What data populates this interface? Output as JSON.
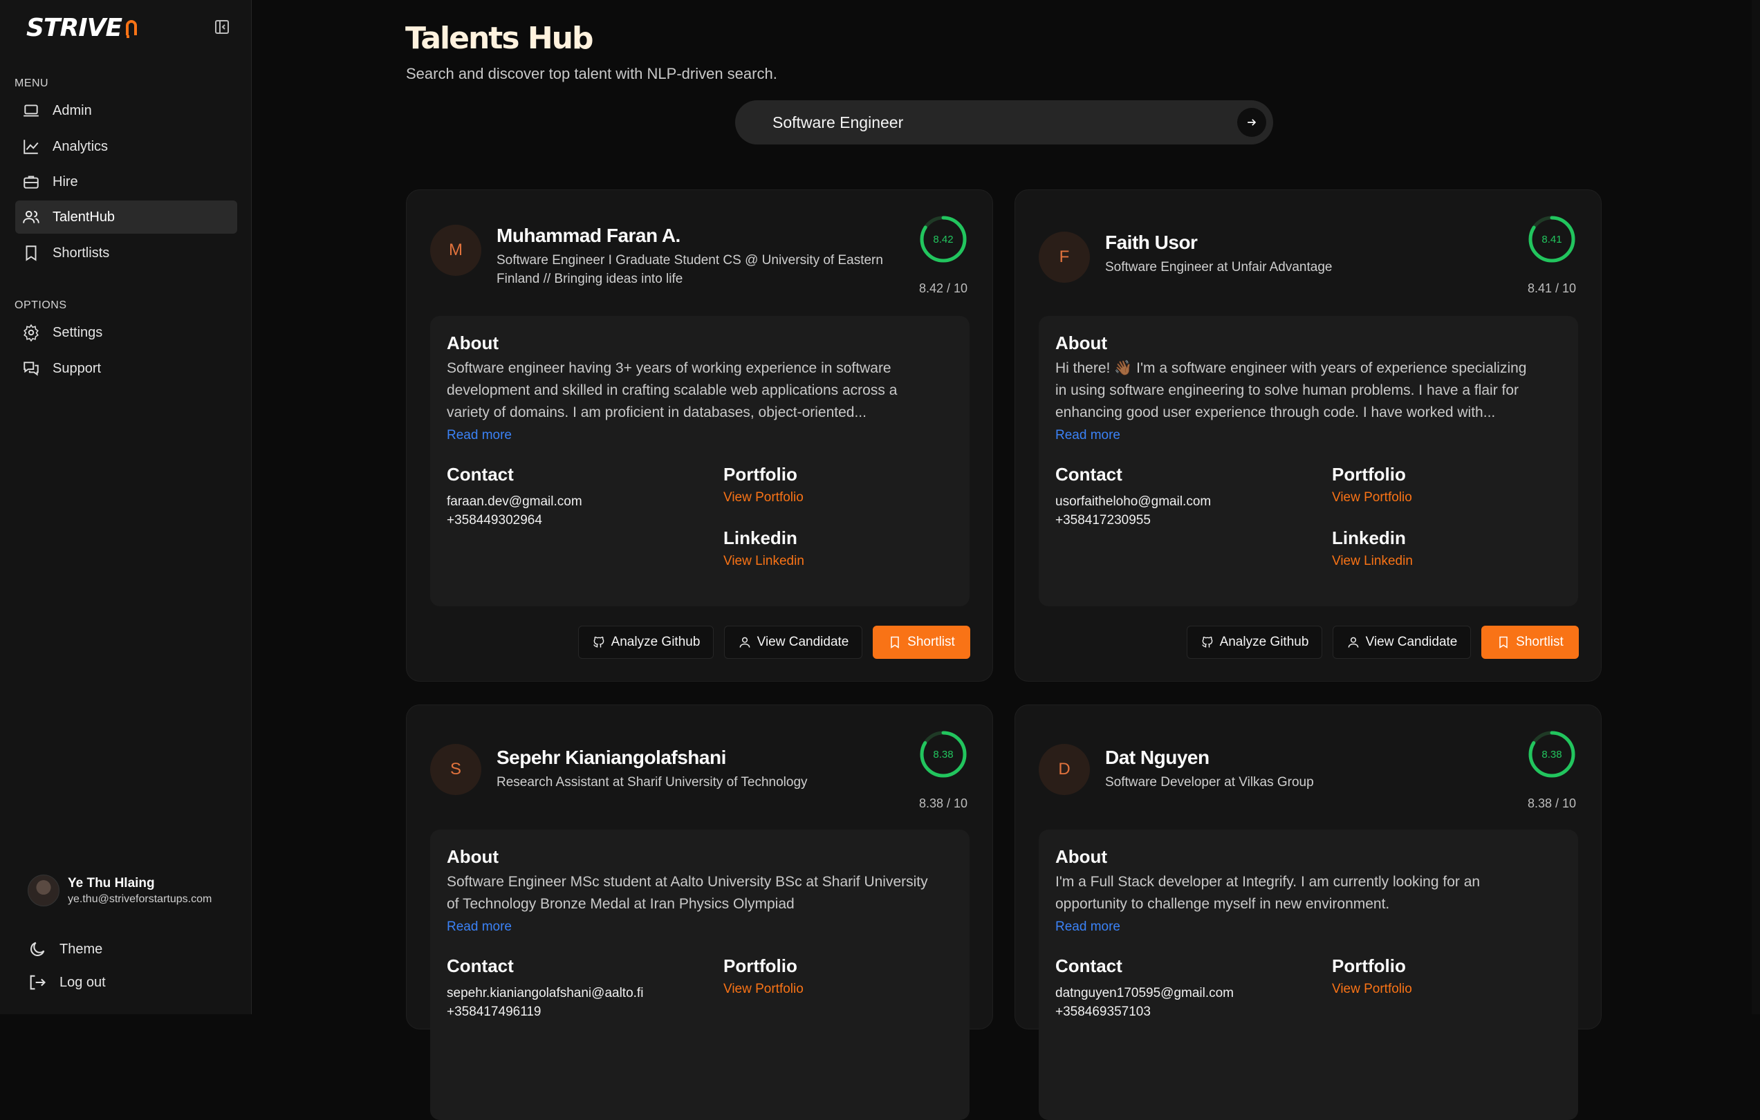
{
  "app": {
    "logo": "STRIVE"
  },
  "sidebar": {
    "menu_label": "MENU",
    "menu": [
      {
        "label": "Admin",
        "icon": "laptop-icon"
      },
      {
        "label": "Analytics",
        "icon": "line-chart-icon"
      },
      {
        "label": "Hire",
        "icon": "briefcase-icon"
      },
      {
        "label": "TalentHub",
        "icon": "users-icon",
        "active": true
      },
      {
        "label": "Shortlists",
        "icon": "bookmark-icon"
      }
    ],
    "options_label": "OPTIONS",
    "options": [
      {
        "label": "Settings",
        "icon": "gear-icon"
      },
      {
        "label": "Support",
        "icon": "chat-icon"
      }
    ],
    "user": {
      "name": "Ye Thu Hlaing",
      "email": "ye.thu@striveforstartups.com"
    },
    "footer": {
      "theme": "Theme",
      "logout": "Log out"
    }
  },
  "header": {
    "title": "Talents Hub",
    "subtitle": "Search and discover top talent with NLP-driven search."
  },
  "search": {
    "value": "Software Engineer"
  },
  "labels": {
    "about": "About",
    "read_more": "Read more",
    "contact": "Contact",
    "portfolio": "Portfolio",
    "view_portfolio": "View Portfolio",
    "linkedin": "Linkedin",
    "view_linkedin": "View Linkedin",
    "analyze_github": "Analyze Github",
    "view_candidate": "View Candidate",
    "shortlist": "Shortlist"
  },
  "candidates": [
    {
      "initial": "M",
      "name": "Muhammad Faran A.",
      "title": "Software Engineer I Graduate Student CS @ University of Eastern Finland // Bringing ideas into life",
      "score": "8.42",
      "score_text": "8.42 / 10",
      "score_value": 0.842,
      "about_lines": [
        "Software engineer having 3+ years of working experience in software",
        "development and skilled in crafting scalable web applications across a",
        "variety of domains. I am proficient in databases, object-oriented..."
      ],
      "email": "faraan.dev@gmail.com",
      "phone": "+358449302964"
    },
    {
      "initial": "F",
      "name": "Faith Usor",
      "title": "Software Engineer at Unfair Advantage",
      "score": "8.41",
      "score_text": "8.41 / 10",
      "score_value": 0.841,
      "about_lines": [
        "Hi there! 👋🏾 I'm a software engineer with years of experience specializing",
        "in using software engineering to solve human problems. I have a flair for",
        "enhancing good user experience through code. I have worked with..."
      ],
      "email": "usorfaitheloho@gmail.com",
      "phone": "+358417230955"
    },
    {
      "initial": "S",
      "name": "Sepehr Kianiangolafshani",
      "title": "Research Assistant at Sharif University of Technology",
      "score": "8.38",
      "score_text": "8.38 / 10",
      "score_value": 0.838,
      "about_lines": [
        "Software Engineer MSc student at Aalto University BSc at Sharif University",
        "of Technology Bronze Medal at Iran Physics Olympiad"
      ],
      "email": "sepehr.kianiangolafshani@aalto.fi",
      "phone": "+358417496119"
    },
    {
      "initial": "D",
      "name": "Dat Nguyen",
      "title": "Software Developer at Vilkas Group",
      "score": "8.38",
      "score_text": "8.38 / 10",
      "score_value": 0.838,
      "about_lines": [
        "I'm a Full Stack developer at Integrify. I am currently looking for an",
        "opportunity to challenge myself in new environment."
      ],
      "email": "datnguyen170595@gmail.com",
      "phone": "+358469357103"
    }
  ],
  "colors": {
    "accent": "#f97316",
    "score_ring": "#22c55e",
    "link": "#3b82f6"
  }
}
